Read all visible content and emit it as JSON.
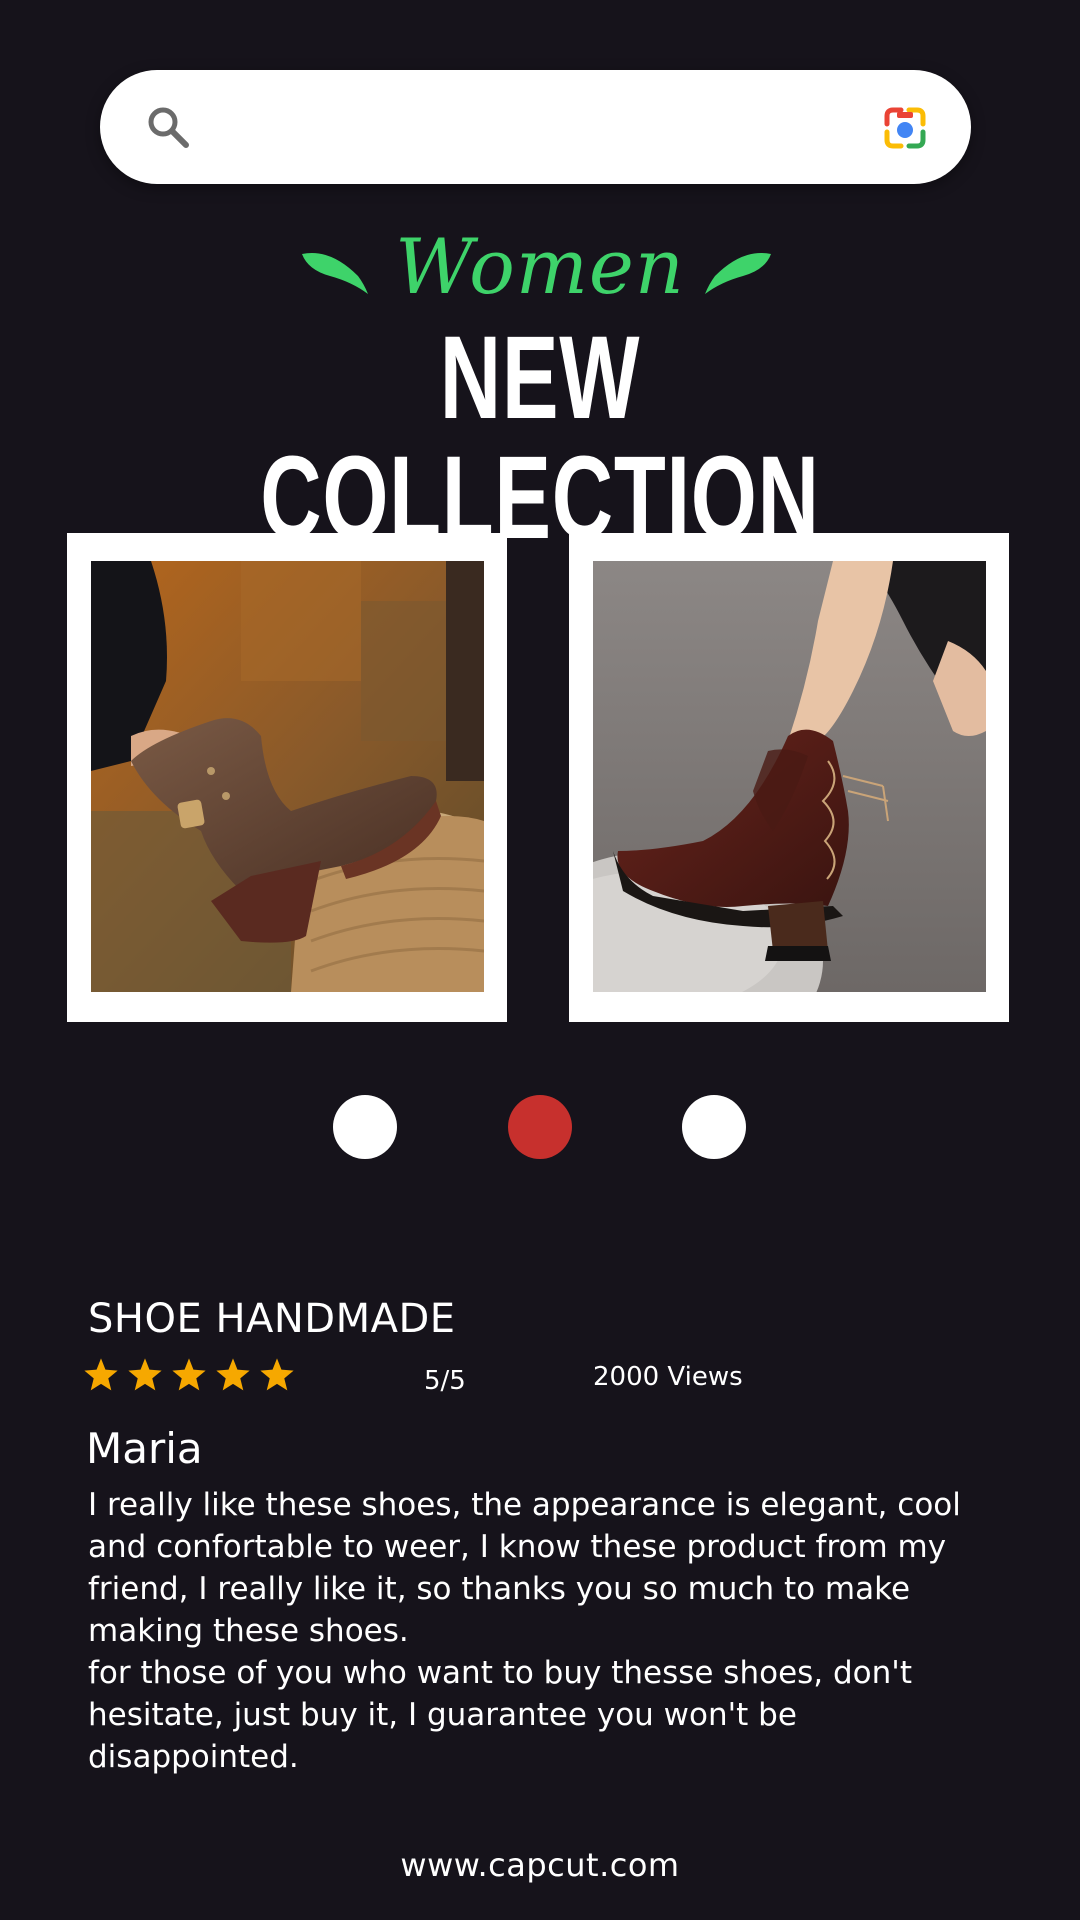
{
  "search": {
    "placeholder": "",
    "value": ""
  },
  "icons": {
    "search": "search-icon",
    "camera": "camera-lens-icon",
    "leaf": "leaf-icon",
    "star": "star-icon"
  },
  "colors": {
    "background": "#16131b",
    "accent_green": "#3ed36a",
    "active_dot": "#c7302d",
    "inactive_dot": "#ffffff",
    "star": "#f6a800"
  },
  "header": {
    "tagline": "Women",
    "title": "NEW COLLECTION"
  },
  "products": [
    {
      "image": "brown leather ankle boot with buckle strap on woven ottoman"
    },
    {
      "image": "dark brown chelsea boot with side lace-up on stone"
    }
  ],
  "carousel": {
    "dots": 3,
    "active_index": 1
  },
  "review": {
    "product_name": "SHOE HANDMADE",
    "stars": 5,
    "rating": "5/5",
    "views": "2000 Views",
    "reviewer": "Maria",
    "text": "I really like these shoes, the appearance is elegant, cool\nand confortable to weer, I know these product from my\nfriend, I really like it, so thanks you so much to make\nmaking these shoes.\nfor those of you who want to buy thesse shoes, don't\nhesitate, just buy it, I guarantee you won't be\ndisappointed."
  },
  "footer": {
    "url": "www.capcut.com"
  }
}
